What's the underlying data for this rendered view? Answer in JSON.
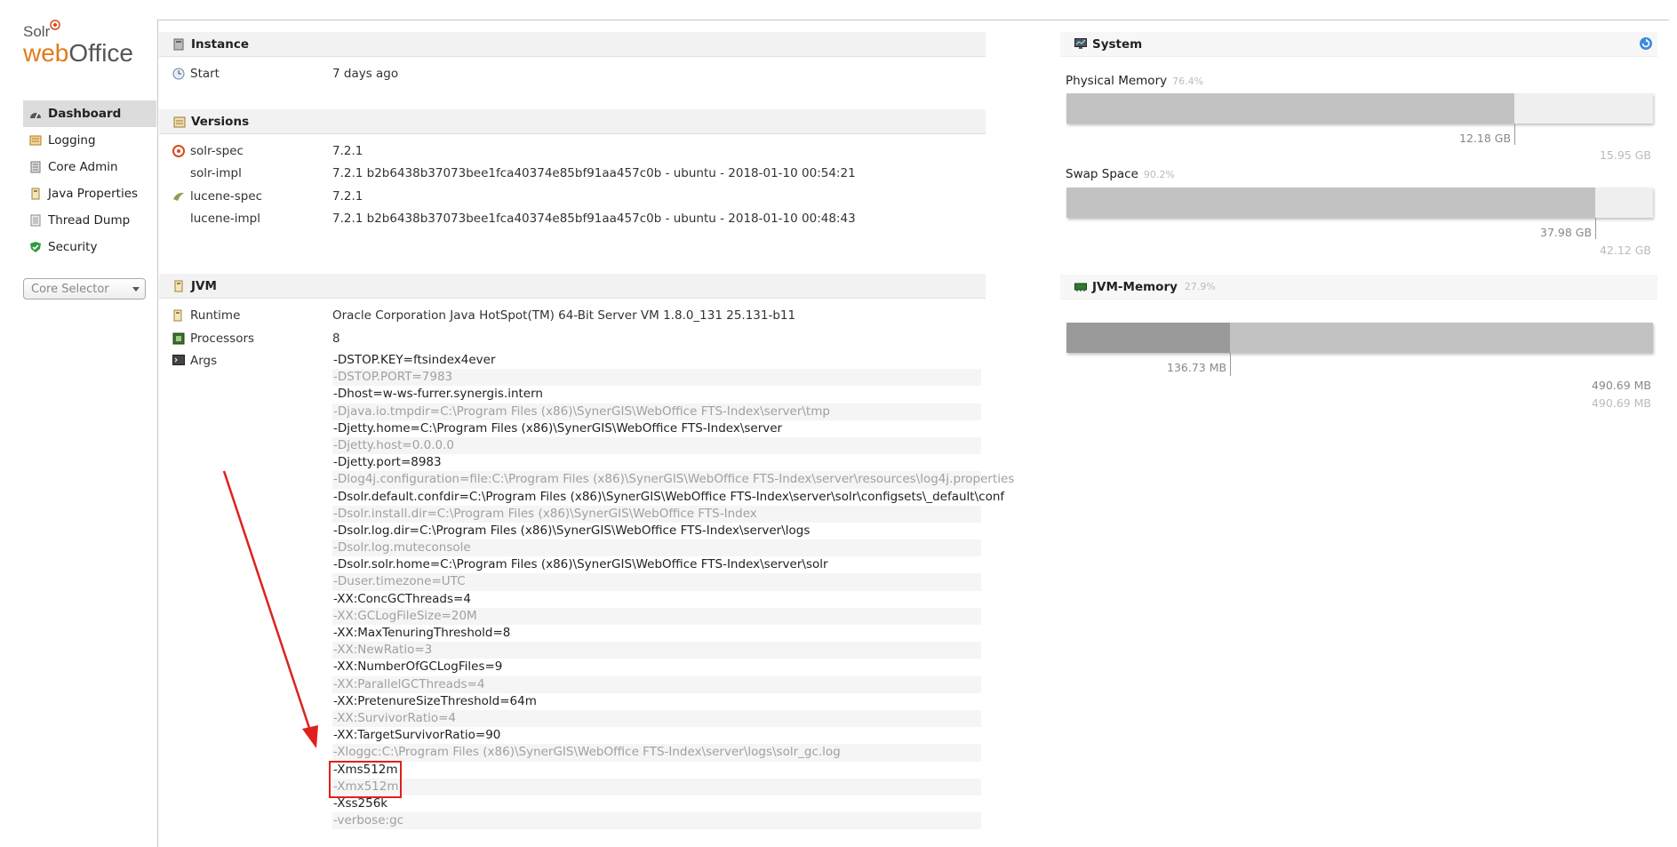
{
  "logo": {
    "top": "Solr",
    "web": "web",
    "office": "Office"
  },
  "sidebar": {
    "items": [
      {
        "label": "Dashboard",
        "icon": "dashboard-icon",
        "active": true
      },
      {
        "label": "Logging",
        "icon": "logging-icon"
      },
      {
        "label": "Core Admin",
        "icon": "core-admin-icon"
      },
      {
        "label": "Java Properties",
        "icon": "java-properties-icon"
      },
      {
        "label": "Thread Dump",
        "icon": "thread-dump-icon"
      },
      {
        "label": "Security",
        "icon": "security-icon"
      }
    ],
    "core_selector": "Core Selector"
  },
  "instance": {
    "title": "Instance",
    "start_label": "Start",
    "start_value": "7 days ago"
  },
  "versions": {
    "title": "Versions",
    "rows": [
      {
        "label": "solr-spec",
        "value": "7.2.1"
      },
      {
        "label": "solr-impl",
        "value": "7.2.1 b2b6438b37073bee1fca40374e85bf91aa457c0b - ubuntu - 2018-01-10 00:54:21"
      },
      {
        "label": "lucene-spec",
        "value": "7.2.1"
      },
      {
        "label": "lucene-impl",
        "value": "7.2.1 b2b6438b37073bee1fca40374e85bf91aa457c0b - ubuntu - 2018-01-10 00:48:43"
      }
    ]
  },
  "jvm": {
    "title": "JVM",
    "runtime_label": "Runtime",
    "runtime_value": "Oracle Corporation Java HotSpot(TM) 64-Bit Server VM 1.8.0_131 25.131-b11",
    "processors_label": "Processors",
    "processors_value": "8",
    "args_label": "Args",
    "args": [
      "-DSTOP.KEY=ftsindex4ever",
      "-DSTOP.PORT=7983",
      "-Dhost=w-ws-furrer.synergis.intern",
      "-Djava.io.tmpdir=C:\\Program Files (x86)\\SynerGIS\\WebOffice FTS-Index\\server\\tmp",
      "-Djetty.home=C:\\Program Files (x86)\\SynerGIS\\WebOffice FTS-Index\\server",
      "-Djetty.host=0.0.0.0",
      "-Djetty.port=8983",
      "-Dlog4j.configuration=file:C:\\Program Files (x86)\\SynerGIS\\WebOffice FTS-Index\\server\\resources\\log4j.properties",
      "-Dsolr.default.confdir=C:\\Program Files (x86)\\SynerGIS\\WebOffice FTS-Index\\server\\solr\\configsets\\_default\\conf",
      "-Dsolr.install.dir=C:\\Program Files (x86)\\SynerGIS\\WebOffice FTS-Index",
      "-Dsolr.log.dir=C:\\Program Files (x86)\\SynerGIS\\WebOffice FTS-Index\\server\\logs",
      "-Dsolr.log.muteconsole",
      "-Dsolr.solr.home=C:\\Program Files (x86)\\SynerGIS\\WebOffice FTS-Index\\server\\solr",
      "-Duser.timezone=UTC",
      "-XX:ConcGCThreads=4",
      "-XX:GCLogFileSize=20M",
      "-XX:MaxTenuringThreshold=8",
      "-XX:NewRatio=3",
      "-XX:NumberOfGCLogFiles=9",
      "-XX:ParallelGCThreads=4",
      "-XX:PretenureSizeThreshold=64m",
      "-XX:SurvivorRatio=4",
      "-XX:TargetSurvivorRatio=90",
      "-Xloggc:C:\\Program Files (x86)\\SynerGIS\\WebOffice FTS-Index\\server\\logs\\solr_gc.log",
      "-Xms512m",
      "-Xmx512m",
      "-Xss256k",
      "-verbose:gc"
    ]
  },
  "system": {
    "title": "System",
    "physical": {
      "label": "Physical Memory",
      "pct": "76.4%",
      "fraction": 0.764,
      "used": "12.18 GB",
      "total": "15.95 GB"
    },
    "swap": {
      "label": "Swap Space",
      "pct": "90.2%",
      "fraction": 0.902,
      "used": "37.98 GB",
      "total": "42.12 GB"
    }
  },
  "jvm_memory": {
    "title": "JVM-Memory",
    "pct": "27.9%",
    "used_fraction": 0.279,
    "used": "136.73 MB",
    "max": "490.69 MB",
    "total": "490.69 MB"
  },
  "colors": {
    "accent": "#e07b1a",
    "highlight": "#e0201c",
    "arrow": "#e0201c"
  }
}
